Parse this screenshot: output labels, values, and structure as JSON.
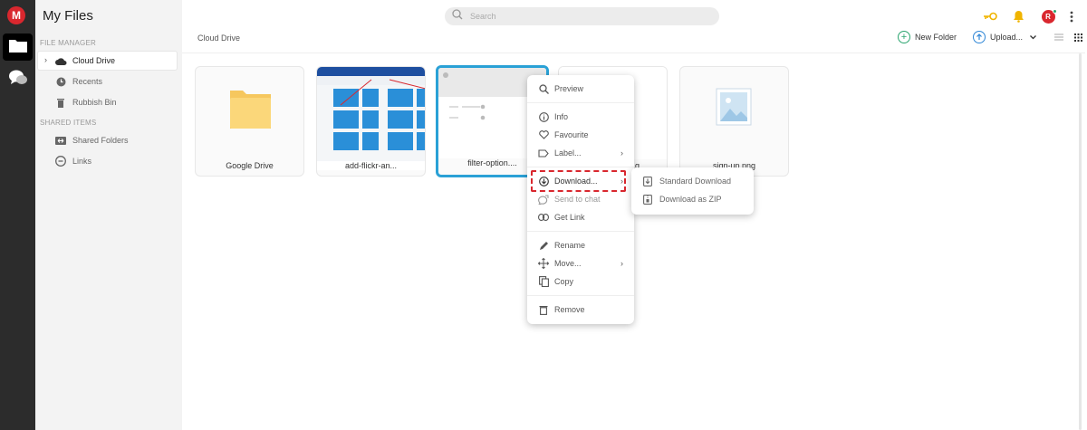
{
  "app": {
    "logo_letter": "M",
    "title": "My Files"
  },
  "search": {
    "placeholder": "Search"
  },
  "sidebar": {
    "file_manager_label": "FILE MANAGER",
    "shared_items_label": "SHARED ITEMS",
    "items": [
      {
        "label": "Cloud Drive",
        "icon": "cloud-icon"
      },
      {
        "label": "Recents",
        "icon": "clock-icon"
      },
      {
        "label": "Rubbish Bin",
        "icon": "trash-icon"
      },
      {
        "label": "Shared Folders",
        "icon": "shared-folder-icon"
      },
      {
        "label": "Links",
        "icon": "link-icon"
      }
    ]
  },
  "topbar": {
    "avatar_letter": "R"
  },
  "breadcrumb": "Cloud Drive",
  "toolbar": {
    "new_folder": "New Folder",
    "upload": "Upload..."
  },
  "files": [
    {
      "name": "Google Drive",
      "type": "folder"
    },
    {
      "name": "add-flickr-an...",
      "type": "image"
    },
    {
      "name": "filter-option....",
      "type": "image"
    },
    {
      "name": "...g",
      "type": "image"
    },
    {
      "name": "sign-up.png",
      "type": "image"
    }
  ],
  "context_menu": {
    "items": [
      {
        "label": "Preview",
        "icon": "search-icon"
      },
      {
        "label": "Info",
        "icon": "info-icon"
      },
      {
        "label": "Favourite",
        "icon": "heart-icon"
      },
      {
        "label": "Label...",
        "icon": "label-icon"
      },
      {
        "label": "Download...",
        "icon": "download-icon"
      },
      {
        "label": "Send to chat",
        "icon": "chat-send-icon"
      },
      {
        "label": "Get Link",
        "icon": "link-icon"
      },
      {
        "label": "Rename",
        "icon": "pencil-icon"
      },
      {
        "label": "Move...",
        "icon": "move-icon"
      },
      {
        "label": "Copy",
        "icon": "copy-icon"
      },
      {
        "label": "Remove",
        "icon": "trash-icon"
      }
    ]
  },
  "download_submenu": {
    "items": [
      {
        "label": "Standard Download",
        "icon": "download-file-icon"
      },
      {
        "label": "Download as ZIP",
        "icon": "zip-icon"
      }
    ]
  },
  "colors": {
    "accent_red": "#d9272e",
    "selection_blue": "#2aa1d6",
    "green": "#2ba56f",
    "blue": "#2f86d6"
  }
}
